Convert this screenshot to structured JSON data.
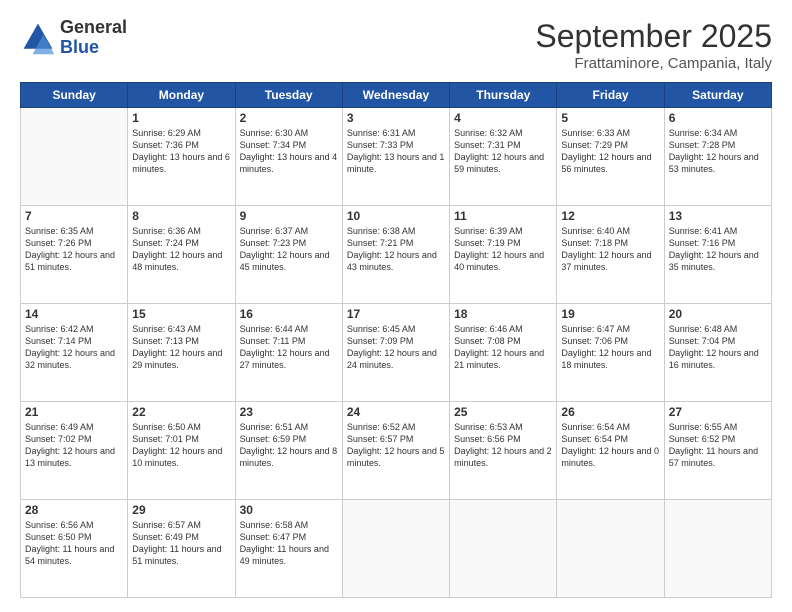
{
  "logo": {
    "general": "General",
    "blue": "Blue"
  },
  "header": {
    "month": "September 2025",
    "location": "Frattaminore, Campania, Italy"
  },
  "weekdays": [
    "Sunday",
    "Monday",
    "Tuesday",
    "Wednesday",
    "Thursday",
    "Friday",
    "Saturday"
  ],
  "weeks": [
    [
      {
        "day": null
      },
      {
        "day": "1",
        "sunrise": "Sunrise: 6:29 AM",
        "sunset": "Sunset: 7:36 PM",
        "daylight": "Daylight: 13 hours and 6 minutes."
      },
      {
        "day": "2",
        "sunrise": "Sunrise: 6:30 AM",
        "sunset": "Sunset: 7:34 PM",
        "daylight": "Daylight: 13 hours and 4 minutes."
      },
      {
        "day": "3",
        "sunrise": "Sunrise: 6:31 AM",
        "sunset": "Sunset: 7:33 PM",
        "daylight": "Daylight: 13 hours and 1 minute."
      },
      {
        "day": "4",
        "sunrise": "Sunrise: 6:32 AM",
        "sunset": "Sunset: 7:31 PM",
        "daylight": "Daylight: 12 hours and 59 minutes."
      },
      {
        "day": "5",
        "sunrise": "Sunrise: 6:33 AM",
        "sunset": "Sunset: 7:29 PM",
        "daylight": "Daylight: 12 hours and 56 minutes."
      },
      {
        "day": "6",
        "sunrise": "Sunrise: 6:34 AM",
        "sunset": "Sunset: 7:28 PM",
        "daylight": "Daylight: 12 hours and 53 minutes."
      }
    ],
    [
      {
        "day": "7",
        "sunrise": "Sunrise: 6:35 AM",
        "sunset": "Sunset: 7:26 PM",
        "daylight": "Daylight: 12 hours and 51 minutes."
      },
      {
        "day": "8",
        "sunrise": "Sunrise: 6:36 AM",
        "sunset": "Sunset: 7:24 PM",
        "daylight": "Daylight: 12 hours and 48 minutes."
      },
      {
        "day": "9",
        "sunrise": "Sunrise: 6:37 AM",
        "sunset": "Sunset: 7:23 PM",
        "daylight": "Daylight: 12 hours and 45 minutes."
      },
      {
        "day": "10",
        "sunrise": "Sunrise: 6:38 AM",
        "sunset": "Sunset: 7:21 PM",
        "daylight": "Daylight: 12 hours and 43 minutes."
      },
      {
        "day": "11",
        "sunrise": "Sunrise: 6:39 AM",
        "sunset": "Sunset: 7:19 PM",
        "daylight": "Daylight: 12 hours and 40 minutes."
      },
      {
        "day": "12",
        "sunrise": "Sunrise: 6:40 AM",
        "sunset": "Sunset: 7:18 PM",
        "daylight": "Daylight: 12 hours and 37 minutes."
      },
      {
        "day": "13",
        "sunrise": "Sunrise: 6:41 AM",
        "sunset": "Sunset: 7:16 PM",
        "daylight": "Daylight: 12 hours and 35 minutes."
      }
    ],
    [
      {
        "day": "14",
        "sunrise": "Sunrise: 6:42 AM",
        "sunset": "Sunset: 7:14 PM",
        "daylight": "Daylight: 12 hours and 32 minutes."
      },
      {
        "day": "15",
        "sunrise": "Sunrise: 6:43 AM",
        "sunset": "Sunset: 7:13 PM",
        "daylight": "Daylight: 12 hours and 29 minutes."
      },
      {
        "day": "16",
        "sunrise": "Sunrise: 6:44 AM",
        "sunset": "Sunset: 7:11 PM",
        "daylight": "Daylight: 12 hours and 27 minutes."
      },
      {
        "day": "17",
        "sunrise": "Sunrise: 6:45 AM",
        "sunset": "Sunset: 7:09 PM",
        "daylight": "Daylight: 12 hours and 24 minutes."
      },
      {
        "day": "18",
        "sunrise": "Sunrise: 6:46 AM",
        "sunset": "Sunset: 7:08 PM",
        "daylight": "Daylight: 12 hours and 21 minutes."
      },
      {
        "day": "19",
        "sunrise": "Sunrise: 6:47 AM",
        "sunset": "Sunset: 7:06 PM",
        "daylight": "Daylight: 12 hours and 18 minutes."
      },
      {
        "day": "20",
        "sunrise": "Sunrise: 6:48 AM",
        "sunset": "Sunset: 7:04 PM",
        "daylight": "Daylight: 12 hours and 16 minutes."
      }
    ],
    [
      {
        "day": "21",
        "sunrise": "Sunrise: 6:49 AM",
        "sunset": "Sunset: 7:02 PM",
        "daylight": "Daylight: 12 hours and 13 minutes."
      },
      {
        "day": "22",
        "sunrise": "Sunrise: 6:50 AM",
        "sunset": "Sunset: 7:01 PM",
        "daylight": "Daylight: 12 hours and 10 minutes."
      },
      {
        "day": "23",
        "sunrise": "Sunrise: 6:51 AM",
        "sunset": "Sunset: 6:59 PM",
        "daylight": "Daylight: 12 hours and 8 minutes."
      },
      {
        "day": "24",
        "sunrise": "Sunrise: 6:52 AM",
        "sunset": "Sunset: 6:57 PM",
        "daylight": "Daylight: 12 hours and 5 minutes."
      },
      {
        "day": "25",
        "sunrise": "Sunrise: 6:53 AM",
        "sunset": "Sunset: 6:56 PM",
        "daylight": "Daylight: 12 hours and 2 minutes."
      },
      {
        "day": "26",
        "sunrise": "Sunrise: 6:54 AM",
        "sunset": "Sunset: 6:54 PM",
        "daylight": "Daylight: 12 hours and 0 minutes."
      },
      {
        "day": "27",
        "sunrise": "Sunrise: 6:55 AM",
        "sunset": "Sunset: 6:52 PM",
        "daylight": "Daylight: 11 hours and 57 minutes."
      }
    ],
    [
      {
        "day": "28",
        "sunrise": "Sunrise: 6:56 AM",
        "sunset": "Sunset: 6:50 PM",
        "daylight": "Daylight: 11 hours and 54 minutes."
      },
      {
        "day": "29",
        "sunrise": "Sunrise: 6:57 AM",
        "sunset": "Sunset: 6:49 PM",
        "daylight": "Daylight: 11 hours and 51 minutes."
      },
      {
        "day": "30",
        "sunrise": "Sunrise: 6:58 AM",
        "sunset": "Sunset: 6:47 PM",
        "daylight": "Daylight: 11 hours and 49 minutes."
      },
      {
        "day": null
      },
      {
        "day": null
      },
      {
        "day": null
      },
      {
        "day": null
      }
    ]
  ]
}
